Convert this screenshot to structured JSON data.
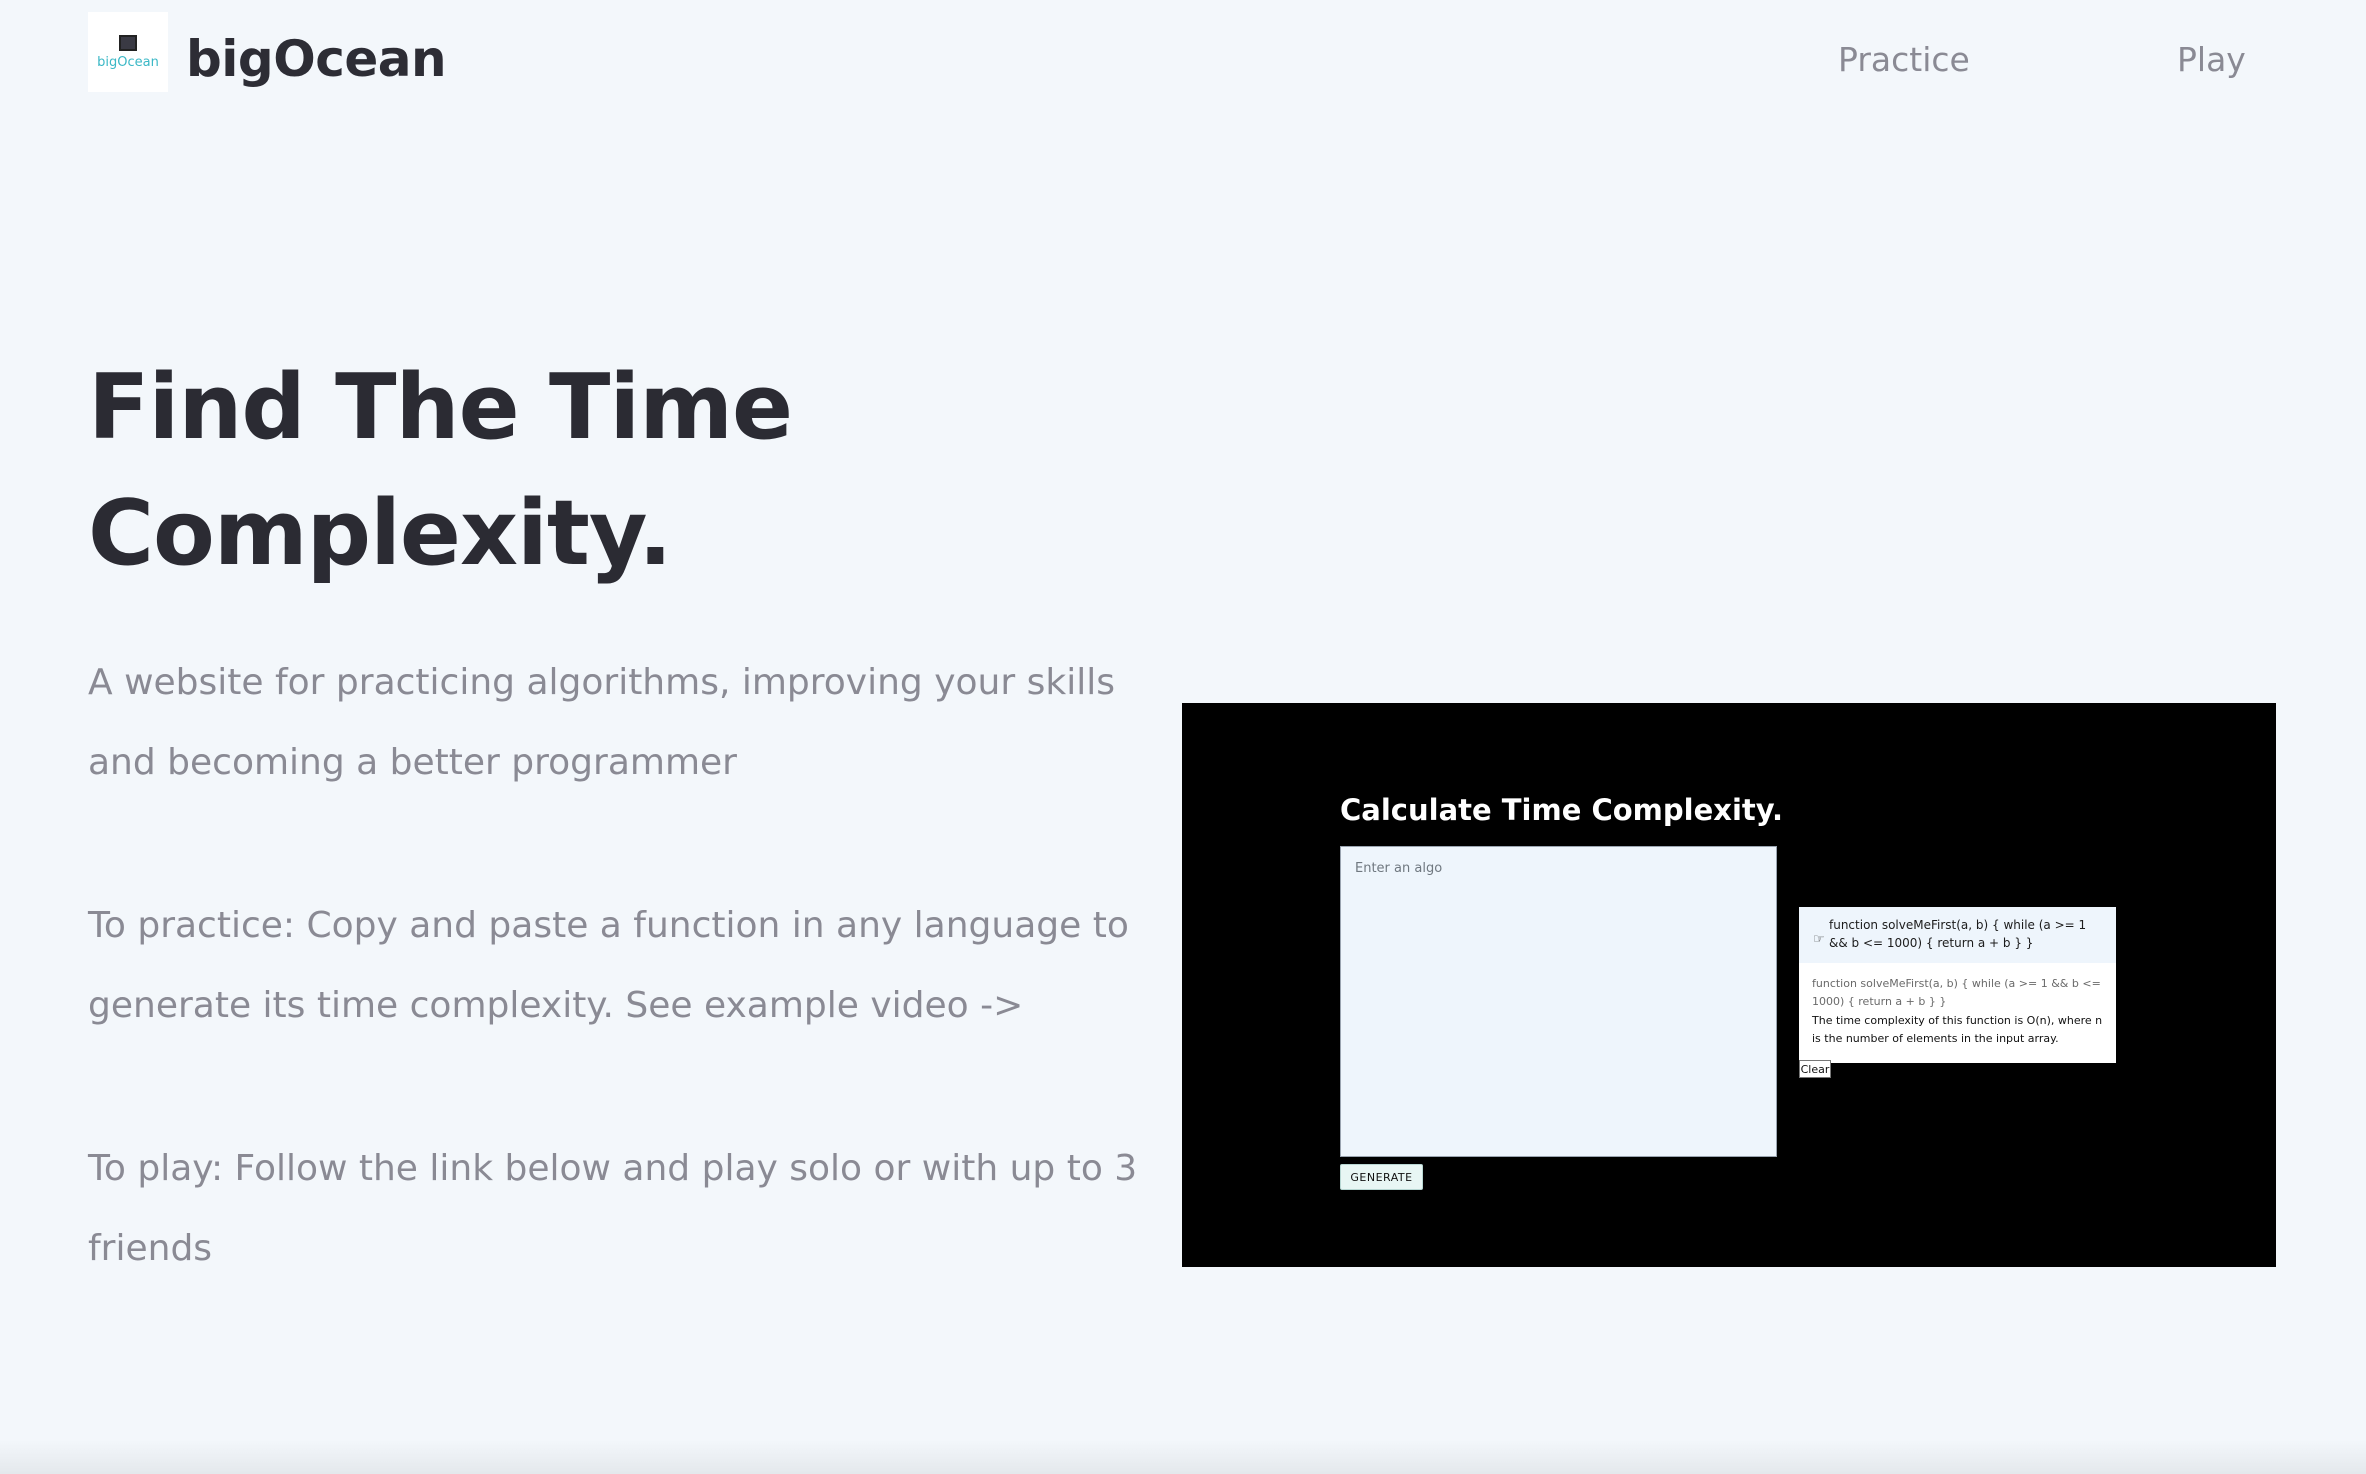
{
  "header": {
    "logo_text": "bigOcean",
    "brand": "bigOcean",
    "nav": {
      "practice": "Practice",
      "play": "Play"
    }
  },
  "hero": {
    "title": "Find The Time Complexity.",
    "intro": "A website for practicing algorithms, improving your skills and becoming a better programmer",
    "practice_text": "To practice: Copy and paste a function in any language to generate its time complexity. See example video ->",
    "play_text": "To play: Follow the link below and play solo or with up to 3 friends"
  },
  "demo": {
    "title": "Calculate Time Complexity.",
    "placeholder": "Enter an algo",
    "generate_label": "GENERATE",
    "result_function": "function solveMeFirst(a, b) { while (a >= 1 && b <= 1000) { return a + b } }",
    "result_echo": "function solveMeFirst(a, b) { while (a >= 1 && b <= 1000) { return a + b } }",
    "result_answer": "The time complexity of this function is O(n), where n is the number of elements in the input array.",
    "clear_label": "Clear"
  },
  "colors": {
    "background": "#f3f7fb",
    "heading": "#2b2b33",
    "body_text": "#8a8a94",
    "logo_accent": "#3bb8c6",
    "demo_background": "#000000"
  }
}
